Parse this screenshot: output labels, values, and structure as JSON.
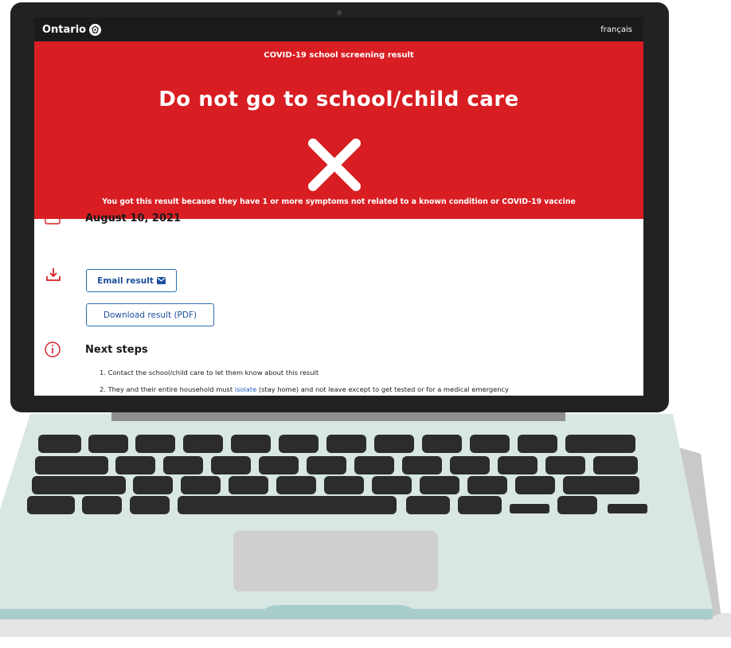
{
  "header": {
    "brand": "Ontario",
    "language_link": "français"
  },
  "banner": {
    "subtitle": "COVID-19 school screening result",
    "headline": "Do not go to school/child care",
    "reason": "You got this result because they have 1 or more symptoms not related to a known condition or COVID-19 vaccine",
    "color": "#d81e23"
  },
  "result": {
    "date": "August 10, 2021",
    "email_button": "Email result",
    "download_button": "Download result (PDF)"
  },
  "next_steps": {
    "title": "Next steps",
    "items": [
      {
        "number": "1.",
        "text": "Contact the school/child care to let them know about this result"
      },
      {
        "number": "2.",
        "before": "They and their entire household must ",
        "link": "isolate",
        "after": " (stay home) and not leave except to get tested or for a medical emergency"
      }
    ]
  },
  "icons": {
    "calendar": "calendar-icon",
    "download": "download-icon",
    "info": "info-icon",
    "mail": "mail-icon",
    "brand": "trillium-icon",
    "result": "x-mark-icon"
  }
}
